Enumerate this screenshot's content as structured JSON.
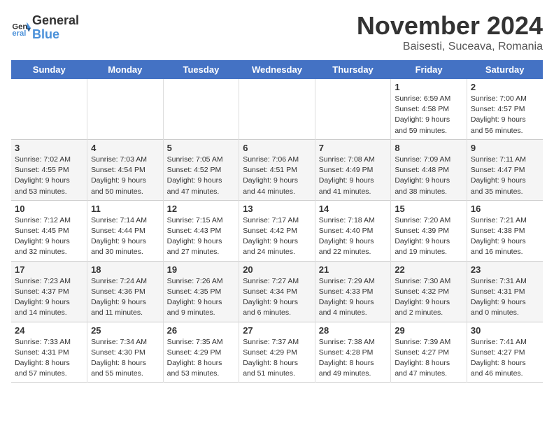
{
  "logo": {
    "text_general": "General",
    "text_blue": "Blue"
  },
  "title": "November 2024",
  "location": "Baisesti, Suceava, Romania",
  "headers": [
    "Sunday",
    "Monday",
    "Tuesday",
    "Wednesday",
    "Thursday",
    "Friday",
    "Saturday"
  ],
  "weeks": [
    [
      {
        "day": "",
        "info": ""
      },
      {
        "day": "",
        "info": ""
      },
      {
        "day": "",
        "info": ""
      },
      {
        "day": "",
        "info": ""
      },
      {
        "day": "",
        "info": ""
      },
      {
        "day": "1",
        "info": "Sunrise: 6:59 AM\nSunset: 4:58 PM\nDaylight: 9 hours and 59 minutes."
      },
      {
        "day": "2",
        "info": "Sunrise: 7:00 AM\nSunset: 4:57 PM\nDaylight: 9 hours and 56 minutes."
      }
    ],
    [
      {
        "day": "3",
        "info": "Sunrise: 7:02 AM\nSunset: 4:55 PM\nDaylight: 9 hours and 53 minutes."
      },
      {
        "day": "4",
        "info": "Sunrise: 7:03 AM\nSunset: 4:54 PM\nDaylight: 9 hours and 50 minutes."
      },
      {
        "day": "5",
        "info": "Sunrise: 7:05 AM\nSunset: 4:52 PM\nDaylight: 9 hours and 47 minutes."
      },
      {
        "day": "6",
        "info": "Sunrise: 7:06 AM\nSunset: 4:51 PM\nDaylight: 9 hours and 44 minutes."
      },
      {
        "day": "7",
        "info": "Sunrise: 7:08 AM\nSunset: 4:49 PM\nDaylight: 9 hours and 41 minutes."
      },
      {
        "day": "8",
        "info": "Sunrise: 7:09 AM\nSunset: 4:48 PM\nDaylight: 9 hours and 38 minutes."
      },
      {
        "day": "9",
        "info": "Sunrise: 7:11 AM\nSunset: 4:47 PM\nDaylight: 9 hours and 35 minutes."
      }
    ],
    [
      {
        "day": "10",
        "info": "Sunrise: 7:12 AM\nSunset: 4:45 PM\nDaylight: 9 hours and 32 minutes."
      },
      {
        "day": "11",
        "info": "Sunrise: 7:14 AM\nSunset: 4:44 PM\nDaylight: 9 hours and 30 minutes."
      },
      {
        "day": "12",
        "info": "Sunrise: 7:15 AM\nSunset: 4:43 PM\nDaylight: 9 hours and 27 minutes."
      },
      {
        "day": "13",
        "info": "Sunrise: 7:17 AM\nSunset: 4:42 PM\nDaylight: 9 hours and 24 minutes."
      },
      {
        "day": "14",
        "info": "Sunrise: 7:18 AM\nSunset: 4:40 PM\nDaylight: 9 hours and 22 minutes."
      },
      {
        "day": "15",
        "info": "Sunrise: 7:20 AM\nSunset: 4:39 PM\nDaylight: 9 hours and 19 minutes."
      },
      {
        "day": "16",
        "info": "Sunrise: 7:21 AM\nSunset: 4:38 PM\nDaylight: 9 hours and 16 minutes."
      }
    ],
    [
      {
        "day": "17",
        "info": "Sunrise: 7:23 AM\nSunset: 4:37 PM\nDaylight: 9 hours and 14 minutes."
      },
      {
        "day": "18",
        "info": "Sunrise: 7:24 AM\nSunset: 4:36 PM\nDaylight: 9 hours and 11 minutes."
      },
      {
        "day": "19",
        "info": "Sunrise: 7:26 AM\nSunset: 4:35 PM\nDaylight: 9 hours and 9 minutes."
      },
      {
        "day": "20",
        "info": "Sunrise: 7:27 AM\nSunset: 4:34 PM\nDaylight: 9 hours and 6 minutes."
      },
      {
        "day": "21",
        "info": "Sunrise: 7:29 AM\nSunset: 4:33 PM\nDaylight: 9 hours and 4 minutes."
      },
      {
        "day": "22",
        "info": "Sunrise: 7:30 AM\nSunset: 4:32 PM\nDaylight: 9 hours and 2 minutes."
      },
      {
        "day": "23",
        "info": "Sunrise: 7:31 AM\nSunset: 4:31 PM\nDaylight: 9 hours and 0 minutes."
      }
    ],
    [
      {
        "day": "24",
        "info": "Sunrise: 7:33 AM\nSunset: 4:31 PM\nDaylight: 8 hours and 57 minutes."
      },
      {
        "day": "25",
        "info": "Sunrise: 7:34 AM\nSunset: 4:30 PM\nDaylight: 8 hours and 55 minutes."
      },
      {
        "day": "26",
        "info": "Sunrise: 7:35 AM\nSunset: 4:29 PM\nDaylight: 8 hours and 53 minutes."
      },
      {
        "day": "27",
        "info": "Sunrise: 7:37 AM\nSunset: 4:29 PM\nDaylight: 8 hours and 51 minutes."
      },
      {
        "day": "28",
        "info": "Sunrise: 7:38 AM\nSunset: 4:28 PM\nDaylight: 8 hours and 49 minutes."
      },
      {
        "day": "29",
        "info": "Sunrise: 7:39 AM\nSunset: 4:27 PM\nDaylight: 8 hours and 47 minutes."
      },
      {
        "day": "30",
        "info": "Sunrise: 7:41 AM\nSunset: 4:27 PM\nDaylight: 8 hours and 46 minutes."
      }
    ]
  ]
}
